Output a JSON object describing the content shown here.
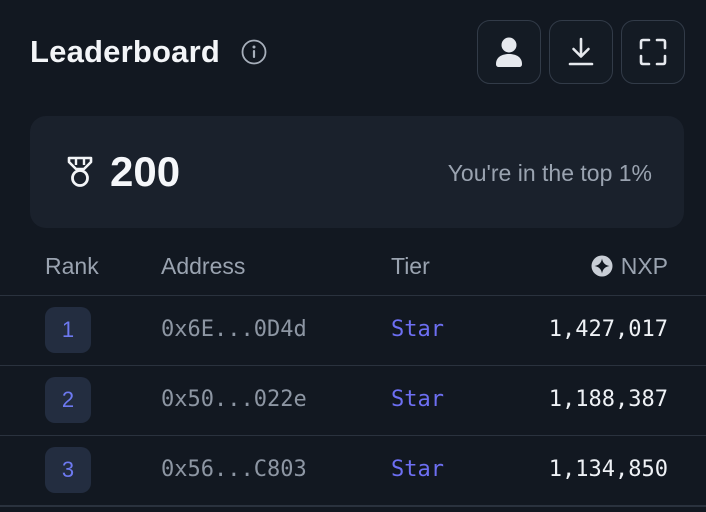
{
  "header": {
    "title": "Leaderboard",
    "buttons": [
      "profile",
      "download",
      "fullscreen"
    ]
  },
  "score_card": {
    "score": "200",
    "top_text": "You're in the top 1%"
  },
  "table": {
    "columns": {
      "rank": "Rank",
      "address": "Address",
      "tier": "Tier",
      "nxp": "NXP"
    },
    "rows": [
      {
        "rank": "1",
        "address": "0x6E...0D4d",
        "tier": "Star",
        "nxp": "1,427,017"
      },
      {
        "rank": "2",
        "address": "0x50...022e",
        "tier": "Star",
        "nxp": "1,188,387"
      },
      {
        "rank": "3",
        "address": "0x56...C803",
        "tier": "Star",
        "nxp": "1,134,850"
      }
    ]
  },
  "colors": {
    "background": "#121821",
    "card": "#1a212c",
    "accent": "#6d6ff2",
    "muted": "#9aa3b0"
  }
}
